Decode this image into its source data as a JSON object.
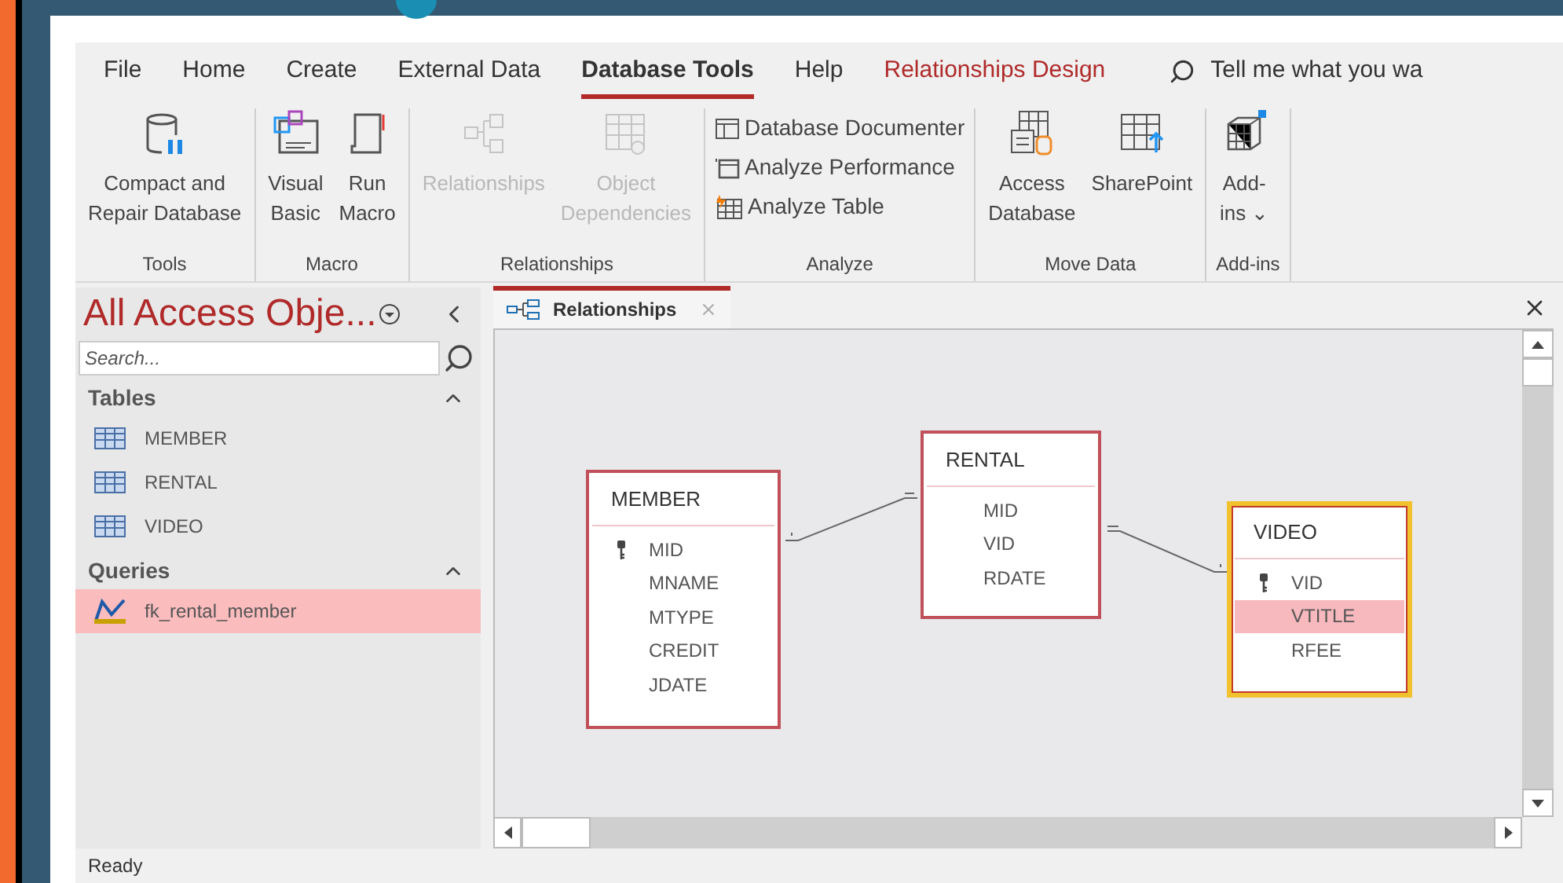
{
  "menu_tabs": [
    {
      "label": "File",
      "kind": "normal",
      "selected": false
    },
    {
      "label": "Home",
      "kind": "normal",
      "selected": false
    },
    {
      "label": "Create",
      "kind": "normal",
      "selected": false
    },
    {
      "label": "External Data",
      "kind": "normal",
      "selected": false
    },
    {
      "label": "Database Tools",
      "kind": "normal",
      "selected": true
    },
    {
      "label": "Help",
      "kind": "normal",
      "selected": false
    },
    {
      "label": "Relationships Design",
      "kind": "contextual",
      "selected": false
    }
  ],
  "tell_me": {
    "placeholder": "Tell me what you wa"
  },
  "ribbon_groups": [
    {
      "label": "Tools",
      "buttons": [
        {
          "kind": "large",
          "lines": [
            "Compact and",
            "Repair Database"
          ],
          "disabled": false
        }
      ]
    },
    {
      "label": "Macro",
      "buttons": [
        {
          "kind": "large",
          "lines": [
            "Visual",
            "Basic"
          ],
          "disabled": false
        },
        {
          "kind": "large",
          "lines": [
            "Run",
            "Macro"
          ],
          "disabled": false
        }
      ]
    },
    {
      "label": "Relationships",
      "buttons": [
        {
          "kind": "large",
          "lines": [
            "Relationships"
          ],
          "disabled": true
        },
        {
          "kind": "large",
          "lines": [
            "Object",
            "Dependencies"
          ],
          "disabled": true
        }
      ]
    },
    {
      "label": "Analyze",
      "buttons": [
        {
          "kind": "small",
          "lines": [
            "Database Documenter"
          ],
          "disabled": false
        },
        {
          "kind": "small",
          "lines": [
            "Analyze Performance"
          ],
          "disabled": false
        },
        {
          "kind": "small",
          "lines": [
            "Analyze Table"
          ],
          "disabled": false
        }
      ]
    },
    {
      "label": "Move Data",
      "buttons": [
        {
          "kind": "large",
          "lines": [
            "Access",
            "Database"
          ],
          "disabled": false
        },
        {
          "kind": "large",
          "lines": [
            "SharePoint"
          ],
          "disabled": false
        }
      ]
    },
    {
      "label": "Add-ins",
      "buttons": [
        {
          "kind": "large",
          "lines": [
            "Add-",
            "ins ⌄"
          ],
          "disabled": false
        }
      ]
    }
  ],
  "nav_pane": {
    "title": "All Access Obje...",
    "search": {
      "placeholder": "Search..."
    },
    "sections": [
      {
        "label": "Tables",
        "expanded": true,
        "items": [
          {
            "label": "MEMBER",
            "kind": "table",
            "selected": false
          },
          {
            "label": "RENTAL",
            "kind": "table",
            "selected": false
          },
          {
            "label": "VIDEO",
            "kind": "table",
            "selected": false
          }
        ]
      },
      {
        "label": "Queries",
        "expanded": true,
        "items": [
          {
            "label": "fk_rental_member",
            "kind": "query",
            "selected": true
          }
        ]
      }
    ]
  },
  "document_tab": {
    "label": "Relationships",
    "selected": true
  },
  "diagram": {
    "tables": [
      {
        "name": "MEMBER",
        "selected": false,
        "fields": [
          {
            "name": "MID",
            "key": true,
            "selected": false
          },
          {
            "name": "MNAME",
            "key": false,
            "selected": false
          },
          {
            "name": "MTYPE",
            "key": false,
            "selected": false
          },
          {
            "name": "CREDIT",
            "key": false,
            "selected": false
          },
          {
            "name": "JDATE",
            "key": false,
            "selected": false
          }
        ]
      },
      {
        "name": "RENTAL",
        "selected": false,
        "fields": [
          {
            "name": "MID",
            "key": false,
            "selected": false
          },
          {
            "name": "VID",
            "key": false,
            "selected": false
          },
          {
            "name": "RDATE",
            "key": false,
            "selected": false
          }
        ]
      },
      {
        "name": "VIDEO",
        "selected": true,
        "fields": [
          {
            "name": "VID",
            "key": true,
            "selected": false
          },
          {
            "name": "VTITLE",
            "key": false,
            "selected": true
          },
          {
            "name": "RFEE",
            "key": false,
            "selected": false
          }
        ]
      }
    ]
  },
  "status_bar": {
    "text": "Ready"
  }
}
